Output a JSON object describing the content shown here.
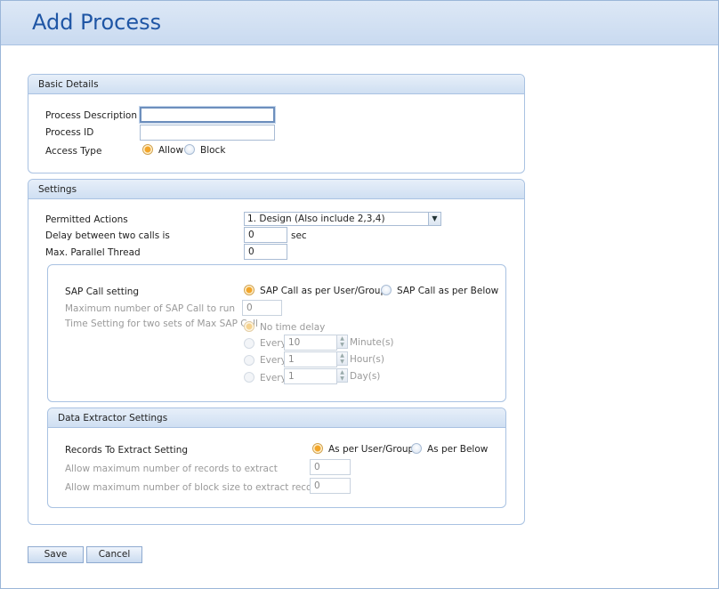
{
  "header": {
    "title": "Add Process"
  },
  "basic": {
    "heading": "Basic Details",
    "process_description_label": "Process Description",
    "process_description_value": "",
    "process_id_label": "Process ID",
    "process_id_value": "",
    "access_type_label": "Access Type",
    "access_options": [
      "Allow",
      "Block"
    ],
    "access_selected": "Allow"
  },
  "settings": {
    "heading": "Settings",
    "permitted_actions_label": "Permitted Actions",
    "permitted_actions_value": "1. Design (Also include 2,3,4)",
    "delay_label": "Delay between two calls is",
    "delay_value": "0",
    "delay_unit": "sec",
    "max_parallel_label": "Max. Parallel Thread",
    "max_parallel_value": "0",
    "sap": {
      "label": "SAP Call setting",
      "options": [
        "SAP Call as per User/Group",
        "SAP Call as per Below"
      ],
      "selected": "SAP Call as per User/Group",
      "max_calls_label": "Maximum number of SAP Call to run",
      "max_calls_value": "0",
      "time_setting_label": "Time Setting for two sets of Max SAP Call",
      "no_delay_label": "No time delay",
      "every_label": "Every",
      "minutes_value": "10",
      "minutes_unit": "Minute(s)",
      "hours_value": "1",
      "hours_unit": "Hour(s)",
      "days_value": "1",
      "days_unit": "Day(s)"
    },
    "extractor": {
      "heading": "Data Extractor Settings",
      "records_label": "Records To Extract Setting",
      "options": [
        "As per User/Group",
        "As per Below"
      ],
      "selected": "As per User/Group",
      "max_records_label": "Allow maximum number of records to extract",
      "max_records_value": "0",
      "max_block_label": "Allow maximum number of block size to extract records",
      "max_block_value": "0"
    }
  },
  "buttons": {
    "save": "Save",
    "cancel": "Cancel"
  }
}
